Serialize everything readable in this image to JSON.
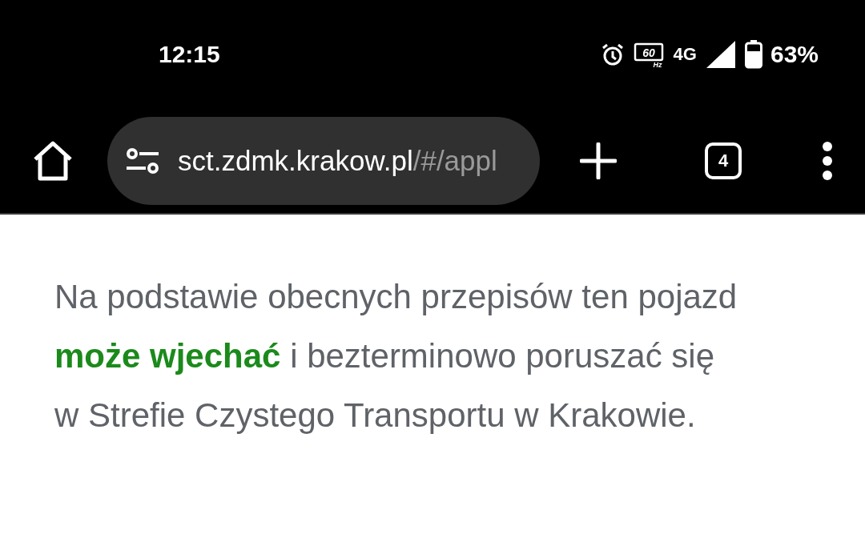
{
  "status_bar": {
    "time": "12:15",
    "refresh_rate": "60",
    "refresh_unit": "Hz",
    "network": "4G",
    "battery": "63%"
  },
  "toolbar": {
    "url_host": "sct.zdmk.krakow.pl",
    "url_path": "/#/appl",
    "tab_count": "4"
  },
  "content": {
    "message": "Na podstawie obecnych przepisów ten pojazd **może wjechać** i bezterminowo poruszać się w Strefie Czystego Transportu w Krakowie."
  }
}
